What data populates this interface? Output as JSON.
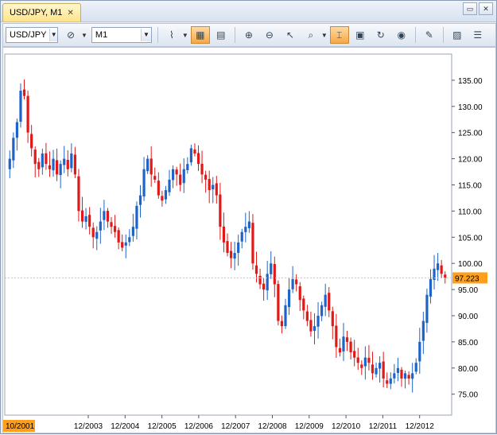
{
  "window": {
    "tab_title": "USD/JPY, M1",
    "close_glyph": "✕",
    "minimize_glyph": "▭",
    "close_window_glyph": "✕"
  },
  "toolbar": {
    "symbol": "USD/JPY",
    "timeframe": "M1",
    "icons": [
      "chart-type-icon",
      "period-separator-icon",
      "zoom-in-icon",
      "zoom-out-icon",
      "cursor-icon",
      "magnify-icon",
      "crosshair-icon",
      "template-icon",
      "refresh-icon",
      "globe-icon",
      "ruler-icon",
      "screenshot-icon",
      "settings-icon"
    ]
  },
  "chart": {
    "price_label": "97.223",
    "current_price": 97.223,
    "start_label": "10/2001",
    "colors": {
      "up": "#1e64c8",
      "down": "#e01818",
      "price_tag": "#ff9f1c",
      "grid": "#cfd6e0"
    }
  },
  "chart_data": {
    "type": "candlestick",
    "ylim": [
      71,
      140
    ],
    "y_ticks": [
      "135.00",
      "130.00",
      "125.00",
      "120.00",
      "115.00",
      "110.00",
      "105.00",
      "100.00",
      "95.00",
      "90.00",
      "85.00",
      "80.00",
      "75.00"
    ],
    "x_ticks": [
      "12/2003",
      "12/2004",
      "12/2005",
      "12/2006",
      "12/2007",
      "12/2008",
      "12/2009",
      "12/2010",
      "12/2011",
      "12/2012"
    ],
    "closes": [
      120,
      124,
      127,
      133,
      132,
      125,
      122,
      119,
      118,
      121,
      119,
      118,
      120,
      117,
      119,
      120,
      118,
      121,
      117,
      110,
      108,
      109,
      107,
      105,
      106,
      108,
      110,
      108,
      107,
      106,
      104,
      103,
      104,
      105,
      107,
      111,
      113,
      118,
      120,
      117,
      116,
      113,
      112,
      114,
      116,
      118,
      117,
      115,
      118,
      119,
      122,
      121,
      119,
      117,
      116,
      114,
      115,
      113,
      107,
      104,
      102,
      101,
      102,
      104,
      106,
      107,
      108,
      100,
      98,
      96,
      95,
      98,
      100,
      96,
      89,
      88,
      92,
      95,
      97,
      96,
      93,
      91,
      89,
      87,
      88,
      90,
      92,
      94,
      91,
      88,
      84,
      83,
      86,
      85,
      83,
      82,
      81,
      80,
      82,
      81,
      79,
      80,
      81,
      78,
      77,
      78,
      79,
      80,
      78,
      79,
      78,
      79,
      81,
      85,
      89,
      94,
      97,
      99,
      100,
      98,
      97.2
    ]
  }
}
